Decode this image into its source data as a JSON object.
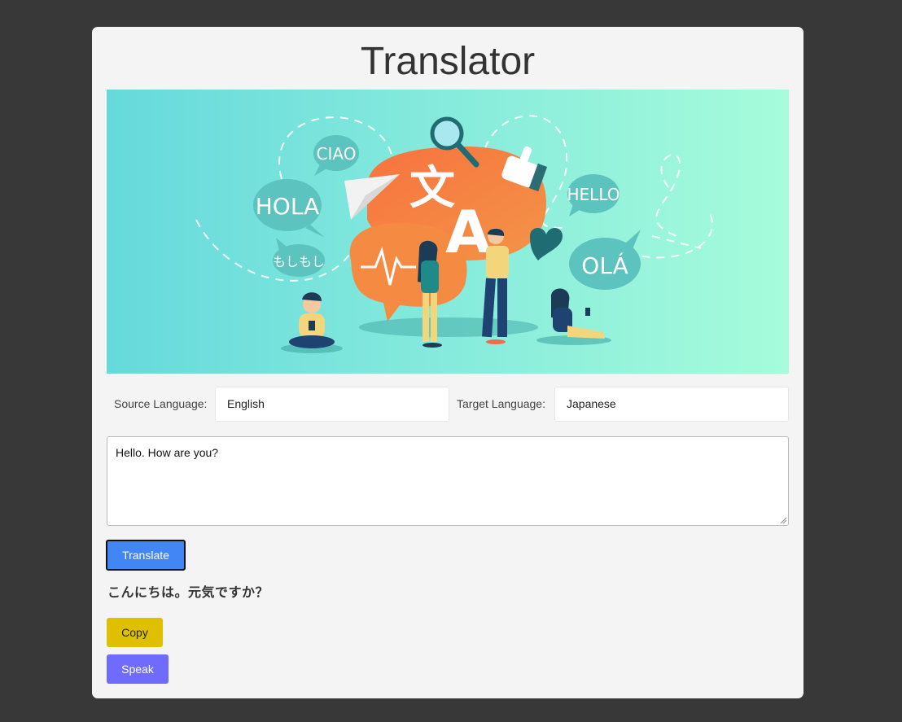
{
  "app": {
    "title": "Translator"
  },
  "banner": {
    "icon": "translation-illustration",
    "bubbles": [
      "CIAO",
      "HOLA",
      "もしもし",
      "HELLO",
      "OLÁ"
    ],
    "glyphs": [
      "文",
      "A"
    ]
  },
  "languages": {
    "source_label": "Source Language:",
    "source_value": "English",
    "target_label": "Target Language:",
    "target_value": "Japanese"
  },
  "input": {
    "value": "Hello. How are you?"
  },
  "actions": {
    "translate_label": "Translate",
    "copy_label": "Copy",
    "speak_label": "Speak"
  },
  "output": {
    "text": "こんにちは。元気ですか？"
  },
  "colors": {
    "page_background": "#383838",
    "card_background": "#f4f4f4",
    "translate_button": "#4285f4",
    "copy_button": "#dfc000",
    "speak_button": "#6f6cfd"
  }
}
